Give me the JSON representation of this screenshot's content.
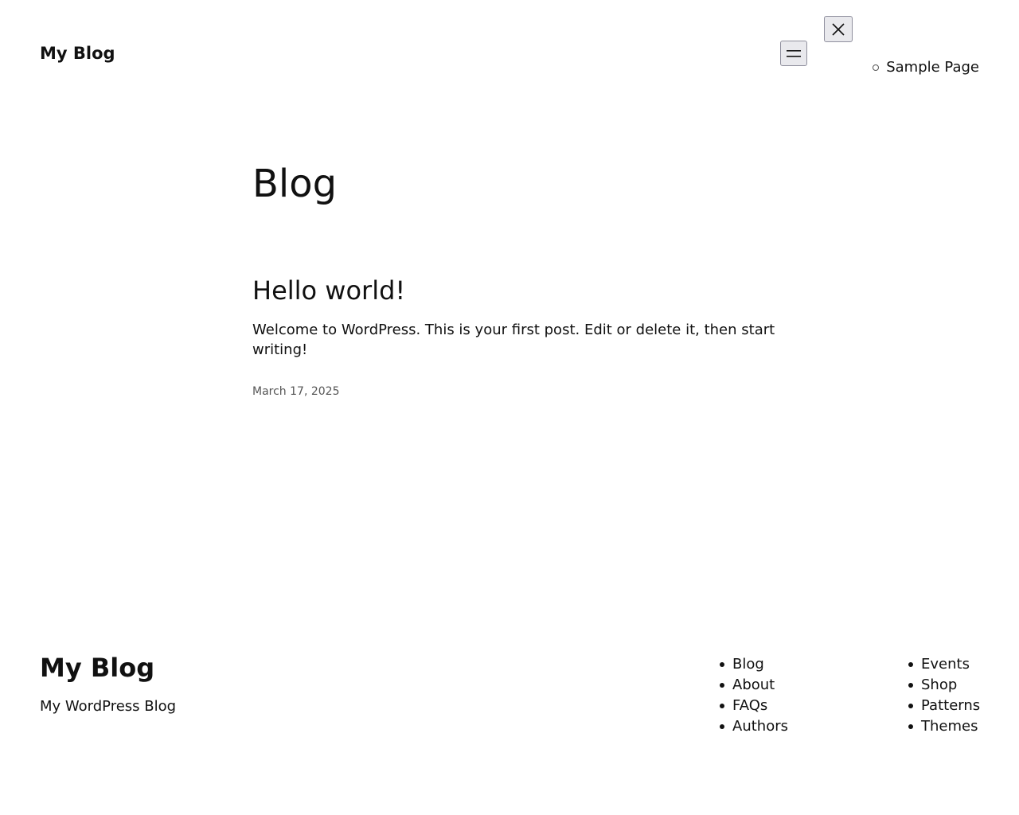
{
  "header": {
    "site_title": "My Blog",
    "menu_button_icon": "hamburger-icon",
    "close_button_icon": "close-icon",
    "nav": [
      {
        "label": "Sample Page"
      }
    ]
  },
  "main": {
    "page_heading": "Blog",
    "post": {
      "title": "Hello world!",
      "excerpt": "Welcome to WordPress. This is your first post. Edit or delete it, then start writing!",
      "date": "March 17, 2025"
    }
  },
  "footer": {
    "site_title": "My Blog",
    "tagline": "My WordPress Blog",
    "links_col1": [
      {
        "label": "Blog"
      },
      {
        "label": "About"
      },
      {
        "label": "FAQs"
      },
      {
        "label": "Authors"
      }
    ],
    "links_col2": [
      {
        "label": "Events"
      },
      {
        "label": "Shop"
      },
      {
        "label": "Patterns"
      },
      {
        "label": "Themes"
      }
    ]
  }
}
